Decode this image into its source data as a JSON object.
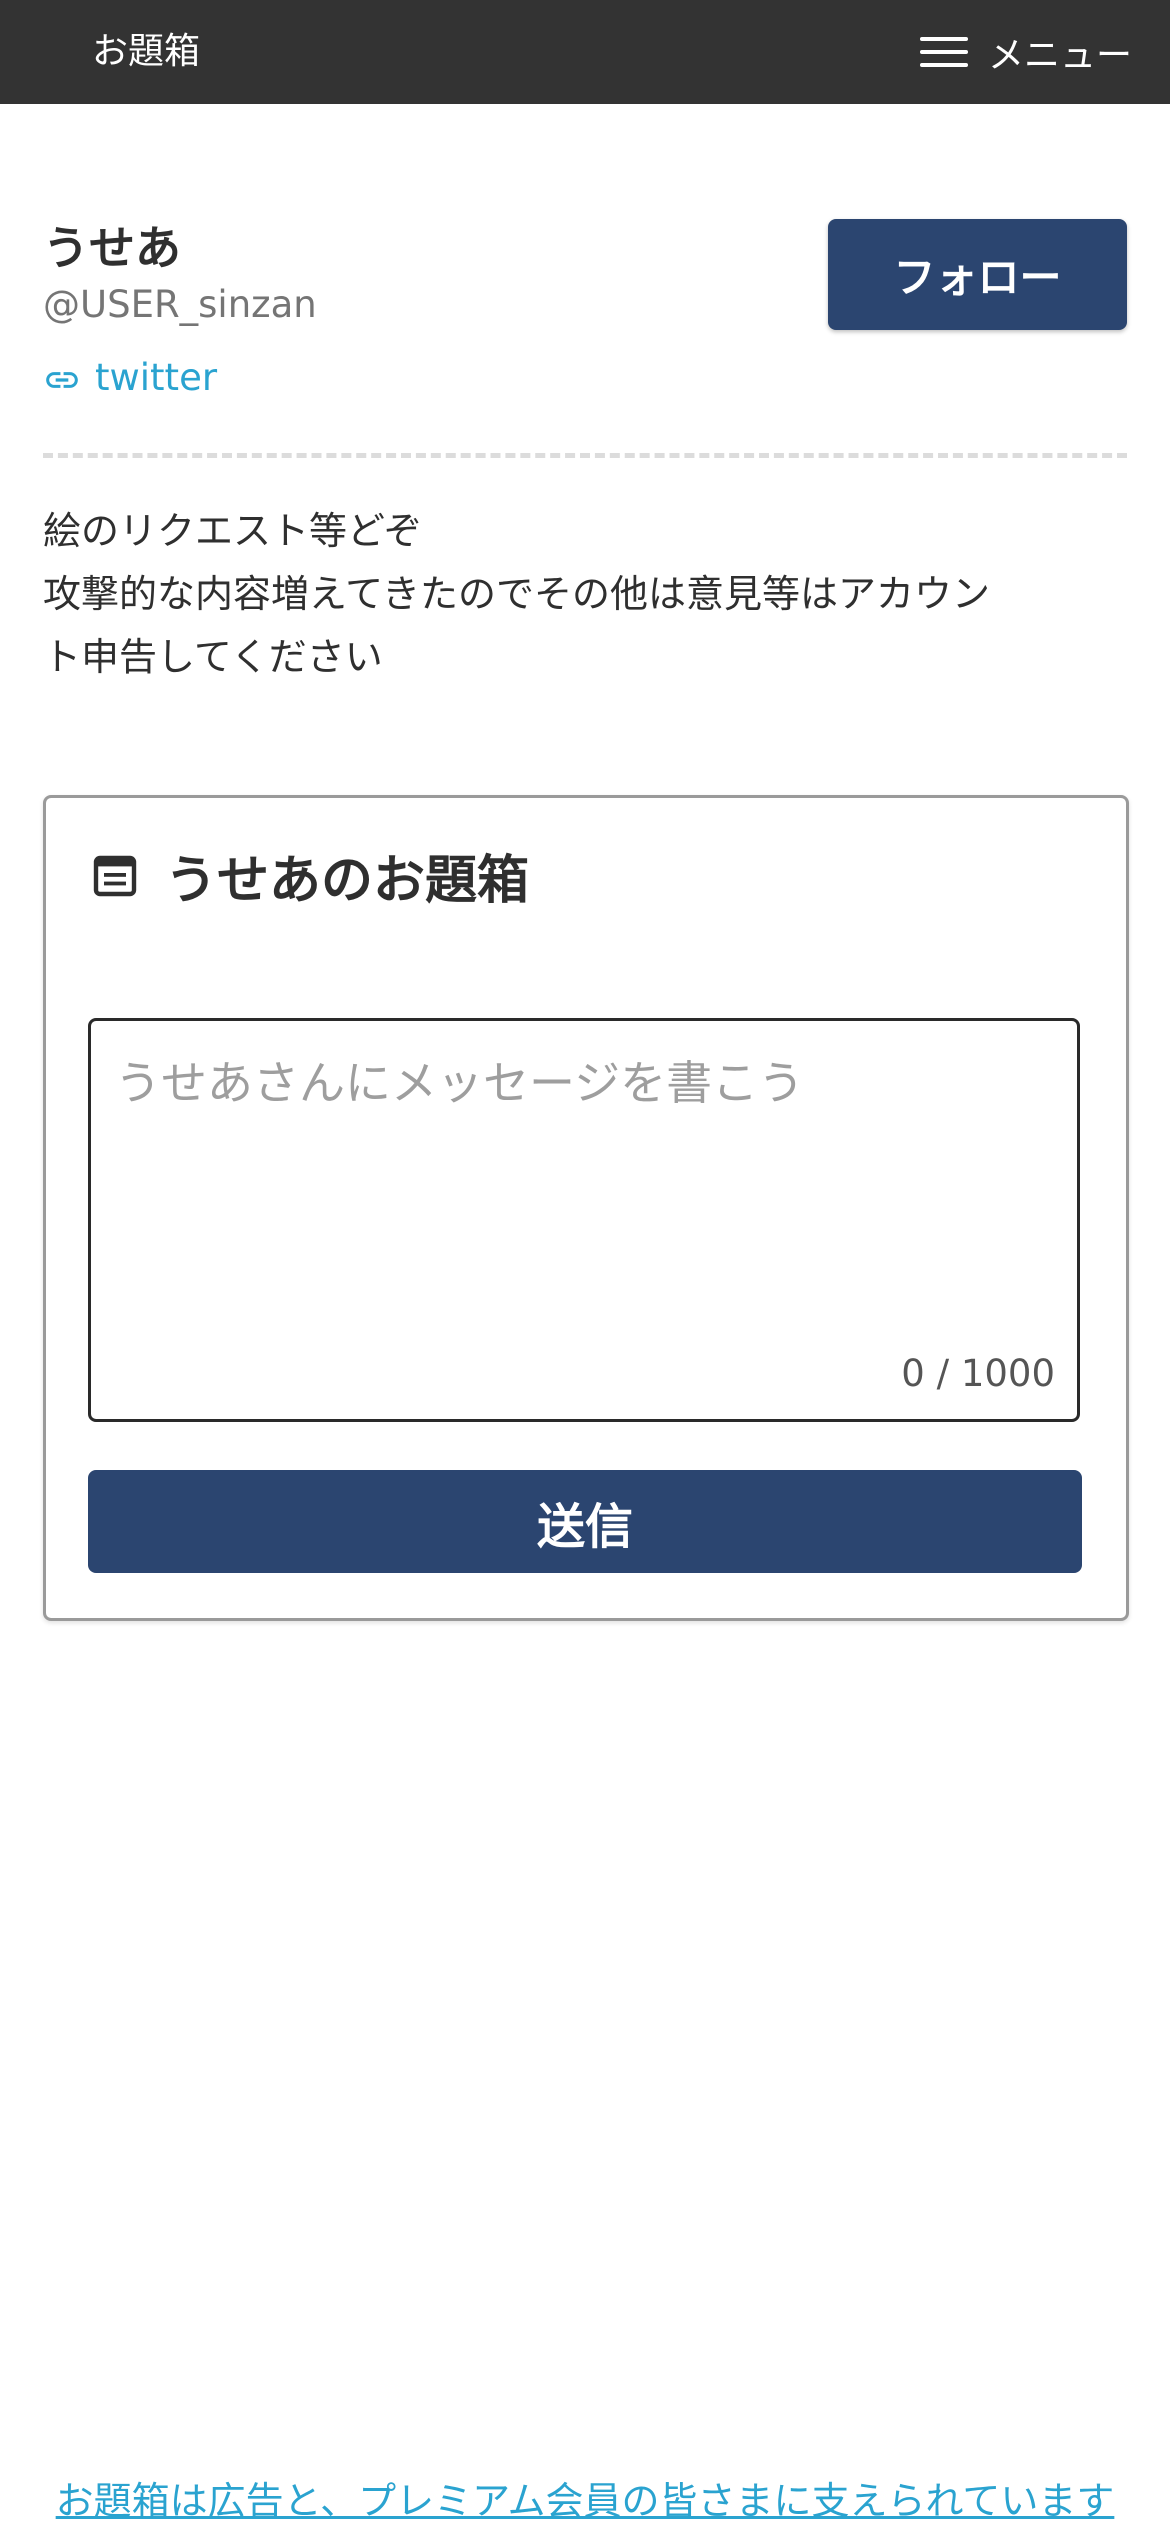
{
  "header": {
    "site_title": "お題箱",
    "menu_label": "メニュー",
    "menu_icon": "hamburger-icon"
  },
  "profile": {
    "name": "うせあ",
    "handle": "@USER_sinzan",
    "link_label": "twitter",
    "link_icon": "link-icon",
    "follow_label": "フォロー",
    "bio_lines": [
      "絵のリクエスト等どぞ",
      "攻撃的な内容増えてきたのでその他は意見等はアカウン",
      "ト申告してください"
    ]
  },
  "odai_box": {
    "icon": "inbox-icon",
    "title": "うせあのお題箱",
    "message_placeholder": "うせあさんにメッセージを書こう",
    "message_value": "",
    "char_count": "0 / 1000",
    "submit_label": "送信"
  },
  "footer": {
    "support_text": "お題箱は広告と、プレミアム会員の皆さまに支えられています"
  },
  "colors": {
    "header_bg": "#333333",
    "primary_button": "#2b4570",
    "link": "#2aa3d0"
  }
}
